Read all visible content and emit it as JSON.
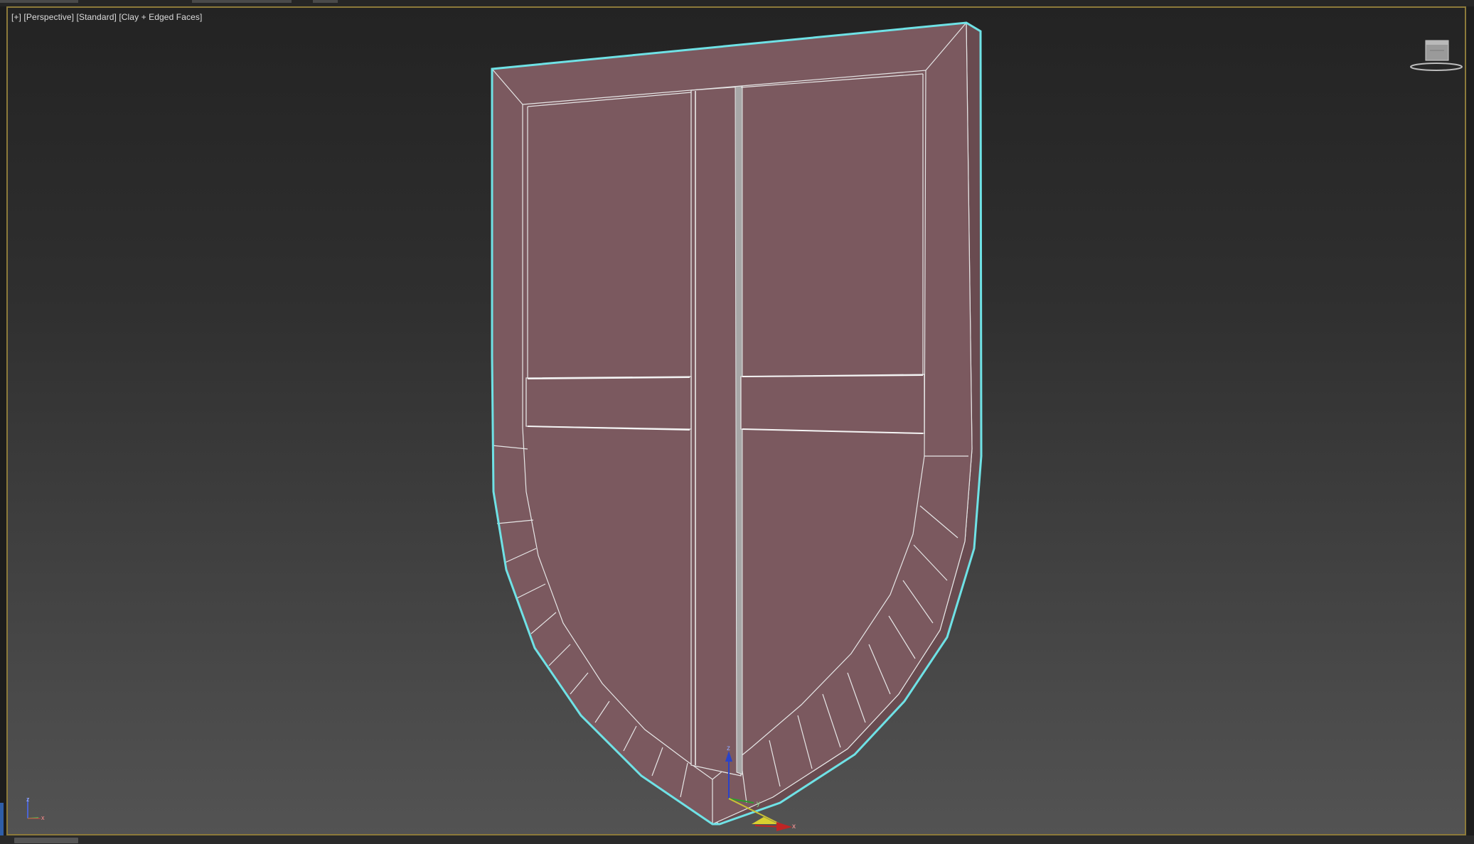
{
  "viewport": {
    "label_plus": "[+]",
    "label_view": "[Perspective]",
    "label_shading": "[Standard]",
    "label_style": "[Clay + Edged Faces]"
  },
  "gizmo": {
    "x_label": "x",
    "y_label": "y",
    "z_label": "z"
  },
  "world_axis": {
    "x_label": "x",
    "z_label": "z"
  },
  "colors": {
    "shield_face": "#7b595f",
    "selection_outline": "#6fe2e6",
    "viewport_border": "#8c7a3a",
    "edge_lines": "#e6e6e6"
  },
  "icons": {
    "viewcube": "viewcube-icon",
    "transform_gizmo": "move-gizmo-icon",
    "world_axis": "axis-tripod-icon"
  }
}
